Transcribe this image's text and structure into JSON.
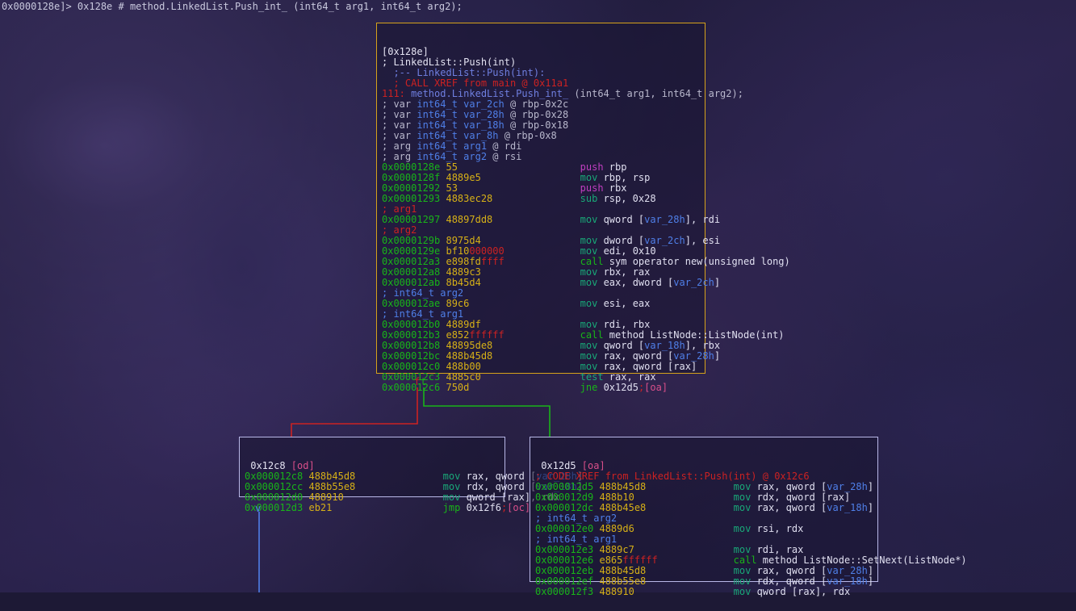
{
  "app": {
    "name": "radare2-graph-view",
    "background_color": "#1f1b3a"
  },
  "prompt": {
    "text": "0x0000128e]> 0x128e # method.LinkedList.Push_int_ (int64_t arg1, int64_t arg2);",
    "address": "0x0000128e",
    "command": "0x128e",
    "symbol": "method.LinkedList.Push_int_",
    "signature": "(int64_t arg1, int64_t arg2);"
  },
  "blocks": {
    "main": {
      "id": "0x128e",
      "border_color": "#d6a21a",
      "header": "[0x128e]",
      "meta": [
        {
          "kind": "comment-white",
          "text": "; LinkedList::Push(int)"
        },
        {
          "kind": "comment-blue",
          "text": "  ;-- LinkedList::Push(int):"
        },
        {
          "kind": "comment-red",
          "text": "  ; CALL XREF from main @ 0x11a1"
        }
      ],
      "signature_line": {
        "number": "111:",
        "symbol": "method.LinkedList.Push_int_",
        "args": " (int64_t arg1, int64_t arg2);"
      },
      "vars": [
        {
          "kw": "; var",
          "type": "int64_t",
          "name": "var_2ch",
          "loc": "@ rbp-0x2c"
        },
        {
          "kw": "; var",
          "type": "int64_t",
          "name": "var_28h",
          "loc": "@ rbp-0x28"
        },
        {
          "kw": "; var",
          "type": "int64_t",
          "name": "var_18h",
          "loc": "@ rbp-0x18"
        },
        {
          "kw": "; var",
          "type": "int64_t",
          "name": "var_8h",
          "loc": "@ rbp-0x8"
        },
        {
          "kw": "; arg",
          "type": "int64_t",
          "name": "arg1",
          "loc": "@ rdi"
        },
        {
          "kw": "; arg",
          "type": "int64_t",
          "name": "arg2",
          "loc": "@ rsi"
        }
      ],
      "instructions": [
        {
          "addr": "0x0000128e",
          "bytes": "55",
          "bytes_red": "",
          "mnemonic": "push",
          "mclass": "c-push",
          "ops": "rbp"
        },
        {
          "addr": "0x0000128f",
          "bytes": "4889e5",
          "bytes_red": "",
          "mnemonic": "mov",
          "mclass": "c-mov",
          "ops": "rbp, rsp"
        },
        {
          "addr": "0x00001292",
          "bytes": "53",
          "bytes_red": "",
          "mnemonic": "push",
          "mclass": "c-push",
          "ops": "rbx"
        },
        {
          "addr": "0x00001293",
          "bytes": "4883ec28",
          "bytes_red": "",
          "mnemonic": "sub",
          "mclass": "c-mov",
          "ops": "rsp, 0x28"
        },
        {
          "comment": "; arg1"
        },
        {
          "addr": "0x00001297",
          "bytes": "48897dd8",
          "bytes_red": "",
          "mnemonic": "mov",
          "mclass": "c-mov",
          "ops": "qword [var_28h], rdi",
          "var": "var_28h"
        },
        {
          "comment": "; arg2"
        },
        {
          "addr": "0x0000129b",
          "bytes": "8975d4",
          "bytes_red": "",
          "mnemonic": "mov",
          "mclass": "c-mov",
          "ops": "dword [var_2ch], esi",
          "var": "var_2ch"
        },
        {
          "addr": "0x0000129e",
          "bytes": "bf10",
          "bytes_red": "000000",
          "mnemonic": "mov",
          "mclass": "c-mov",
          "ops": "edi, 0x10"
        },
        {
          "addr": "0x000012a3",
          "bytes": "e898fd",
          "bytes_red": "ffff",
          "mnemonic": "call",
          "mclass": "c-call",
          "ops": "sym operator new(unsigned long)"
        },
        {
          "addr": "0x000012a8",
          "bytes": "4889c3",
          "bytes_red": "",
          "mnemonic": "mov",
          "mclass": "c-mov",
          "ops": "rbx, rax"
        },
        {
          "addr": "0x000012ab",
          "bytes": "8b45d4",
          "bytes_red": "",
          "mnemonic": "mov",
          "mclass": "c-mov",
          "ops": "eax, dword [var_2ch]",
          "var": "var_2ch"
        },
        {
          "comment-blue": "; int64_t arg2"
        },
        {
          "addr": "0x000012ae",
          "bytes": "89c6",
          "bytes_red": "",
          "mnemonic": "mov",
          "mclass": "c-mov",
          "ops": "esi, eax"
        },
        {
          "comment-blue": "; int64_t arg1"
        },
        {
          "addr": "0x000012b0",
          "bytes": "4889df",
          "bytes_red": "",
          "mnemonic": "mov",
          "mclass": "c-mov",
          "ops": "rdi, rbx"
        },
        {
          "addr": "0x000012b3",
          "bytes": "e852",
          "bytes_red": "ffffff",
          "mnemonic": "call",
          "mclass": "c-call",
          "ops": "method ListNode::ListNode(int)"
        },
        {
          "addr": "0x000012b8",
          "bytes": "48895de8",
          "bytes_red": "",
          "mnemonic": "mov",
          "mclass": "c-mov",
          "ops": "qword [var_18h], rbx",
          "var": "var_18h"
        },
        {
          "addr": "0x000012bc",
          "bytes": "488b45d8",
          "bytes_red": "",
          "mnemonic": "mov",
          "mclass": "c-mov",
          "ops": "rax, qword [var_28h]",
          "var": "var_28h"
        },
        {
          "addr": "0x000012c0",
          "bytes": "488b00",
          "bytes_red": "",
          "mnemonic": "mov",
          "mclass": "c-mov",
          "ops": "rax, qword [rax]"
        },
        {
          "addr": "0x000012c3",
          "bytes": "4885c0",
          "bytes_red": "",
          "mnemonic": "test",
          "mclass": "c-mov",
          "ops": "rax, rax"
        },
        {
          "addr": "0x000012c6",
          "bytes": "750d",
          "bytes_red": "",
          "mnemonic": "jne",
          "mclass": "c-jmp",
          "ops": "0x12d5;[oa]",
          "flag": "[oa]"
        }
      ]
    },
    "false_branch": {
      "id": "0x12c8",
      "flag": "[od]",
      "border_color": "#b9b8e8",
      "instructions": [
        {
          "addr": "0x000012c8",
          "bytes": "488b45d8",
          "bytes_red": "",
          "mnemonic": "mov",
          "mclass": "c-mov",
          "ops": "rax, qword [var_28h]",
          "var": "var_28h"
        },
        {
          "addr": "0x000012cc",
          "bytes": "488b55e8",
          "bytes_red": "",
          "mnemonic": "mov",
          "mclass": "c-mov",
          "ops": "rdx, qword [var_18h]",
          "var": "var_18h"
        },
        {
          "addr": "0x000012d0",
          "bytes": "488910",
          "bytes_red": "",
          "mnemonic": "mov",
          "mclass": "c-mov",
          "ops": "qword [rax], rdx"
        },
        {
          "addr": "0x000012d3",
          "bytes": "eb21",
          "bytes_red": "",
          "mnemonic": "jmp",
          "mclass": "c-jmp",
          "ops": "0x12f6;[oc]",
          "flag": "[oc]"
        }
      ]
    },
    "true_branch": {
      "id": "0x12d5",
      "flag": "[oa]",
      "border_color": "#b9b8e8",
      "xref": "; CODE XREF from LinkedList::Push(int) @ 0x12c6",
      "instructions": [
        {
          "addr": "0x000012d5",
          "bytes": "488b45d8",
          "bytes_red": "",
          "mnemonic": "mov",
          "mclass": "c-mov",
          "ops": "rax, qword [var_28h]",
          "var": "var_28h"
        },
        {
          "addr": "0x000012d9",
          "bytes": "488b10",
          "bytes_red": "",
          "mnemonic": "mov",
          "mclass": "c-mov",
          "ops": "rdx, qword [rax]"
        },
        {
          "addr": "0x000012dc",
          "bytes": "488b45e8",
          "bytes_red": "",
          "mnemonic": "mov",
          "mclass": "c-mov",
          "ops": "rax, qword [var_18h]",
          "var": "var_18h"
        },
        {
          "comment-blue": "; int64_t arg2"
        },
        {
          "addr": "0x000012e0",
          "bytes": "4889d6",
          "bytes_red": "",
          "mnemonic": "mov",
          "mclass": "c-mov",
          "ops": "rsi, rdx"
        },
        {
          "comment-blue": "; int64_t arg1"
        },
        {
          "addr": "0x000012e3",
          "bytes": "4889c7",
          "bytes_red": "",
          "mnemonic": "mov",
          "mclass": "c-mov",
          "ops": "rdi, rax"
        },
        {
          "addr": "0x000012e6",
          "bytes": "e865",
          "bytes_red": "ffffff",
          "mnemonic": "call",
          "mclass": "c-call",
          "ops": "method ListNode::SetNext(ListNode*)"
        },
        {
          "addr": "0x000012eb",
          "bytes": "488b45d8",
          "bytes_red": "",
          "mnemonic": "mov",
          "mclass": "c-mov",
          "ops": "rax, qword [var_28h]",
          "var": "var_28h"
        },
        {
          "addr": "0x000012ef",
          "bytes": "488b55e8",
          "bytes_red": "",
          "mnemonic": "mov",
          "mclass": "c-mov",
          "ops": "rdx, qword [var_18h]",
          "var": "var_18h"
        },
        {
          "addr": "0x000012f3",
          "bytes": "488910",
          "bytes_red": "",
          "mnemonic": "mov",
          "mclass": "c-mov",
          "ops": "qword [rax], rdx"
        }
      ]
    }
  },
  "edges": [
    {
      "label": "f",
      "color": "#cc2222",
      "from": "main",
      "to": "false_branch"
    },
    {
      "label": "t",
      "color": "#19b419",
      "from": "main",
      "to": "true_branch"
    },
    {
      "label": "v",
      "color": "#4f7fe8",
      "from": "false_branch",
      "to": "offscreen"
    }
  ]
}
